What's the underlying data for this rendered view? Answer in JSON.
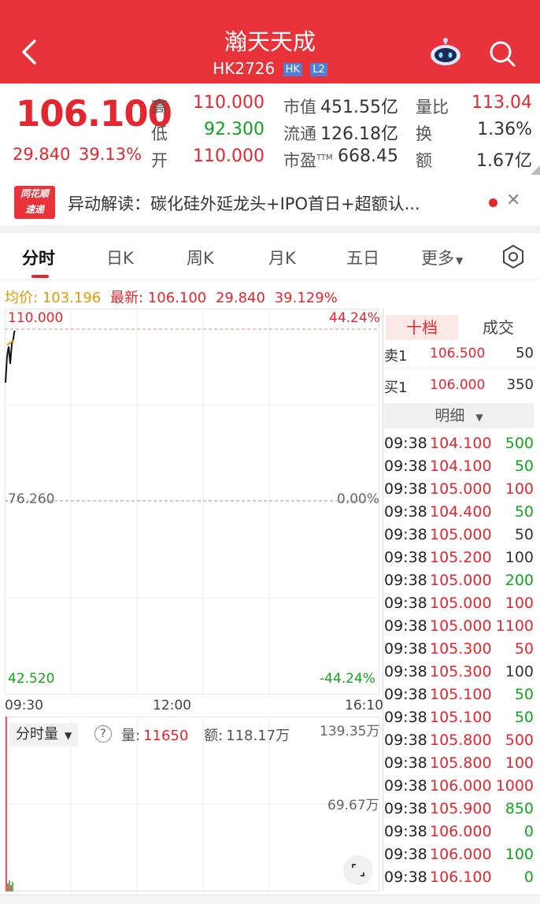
{
  "header": {
    "title": "瀚天天成",
    "code": "HK2726",
    "tag_market": "HK",
    "tag_level": "L2",
    "color": "#e8333a"
  },
  "quote": {
    "price": "106.100",
    "change": "29.840",
    "change_pct": "39.13%",
    "high_label": "高",
    "high": "110.000",
    "low_label": "低",
    "low": "92.300",
    "open_label": "开",
    "open": "110.000",
    "mcap_label": "市值",
    "mcap": "451.55亿",
    "float_label": "流通",
    "float": "126.18亿",
    "pe_label": "市盈",
    "pe_sup": "TTM",
    "pe": "668.45",
    "volratio_label": "量比",
    "volratio": "113.04",
    "turnover_label": "换",
    "turnover": "1.36%",
    "amount_label": "额",
    "amount": "1.67亿"
  },
  "news": {
    "logo_line1": "同花顺",
    "logo_line2": "速递",
    "text": "异动解读：碳化硅外延龙头+IPO首日+超额认..."
  },
  "tabs": [
    "分时",
    "日K",
    "周K",
    "月K",
    "五日",
    "更多"
  ],
  "avg": {
    "avg_label": "均价:",
    "avg_value": "103.196",
    "latest_label": "最新:",
    "latest_value": "106.100",
    "change": "29.840",
    "change_pct": "39.129%"
  },
  "chart": {
    "top_price": "110.000",
    "top_pct": "44.24%",
    "mid_price": "76.260",
    "mid_pct": "0.00%",
    "bottom_price": "42.520",
    "bottom_pct": "-44.24%",
    "time_start": "09:30",
    "time_mid": "12:00",
    "time_end": "16:10"
  },
  "volume": {
    "selector": "分时量",
    "vol_label": "量:",
    "vol_value": "11650",
    "amt_label": "额:",
    "amt_value": "118.17万",
    "axis_top": "139.35万",
    "axis_mid": "69.67万"
  },
  "side": {
    "tab_active": "十档",
    "tab_inactive": "成交",
    "ask_label": "卖1",
    "ask_price": "106.500",
    "ask_vol": "50",
    "bid_label": "买1",
    "bid_price": "106.000",
    "bid_vol": "350",
    "detail": "明细",
    "trades": [
      {
        "t": "09:38",
        "p": "104.100",
        "v": "500",
        "vc": "green"
      },
      {
        "t": "09:38",
        "p": "104.100",
        "v": "50",
        "vc": "green"
      },
      {
        "t": "09:38",
        "p": "105.000",
        "v": "100",
        "vc": "red"
      },
      {
        "t": "09:38",
        "p": "104.400",
        "v": "50",
        "vc": "green"
      },
      {
        "t": "09:38",
        "p": "105.000",
        "v": "50",
        "vc": "dark"
      },
      {
        "t": "09:38",
        "p": "105.200",
        "v": "100",
        "vc": "dark"
      },
      {
        "t": "09:38",
        "p": "105.000",
        "v": "200",
        "vc": "green"
      },
      {
        "t": "09:38",
        "p": "105.000",
        "v": "100",
        "vc": "red"
      },
      {
        "t": "09:38",
        "p": "105.000",
        "v": "1100",
        "vc": "red"
      },
      {
        "t": "09:38",
        "p": "105.300",
        "v": "50",
        "vc": "red"
      },
      {
        "t": "09:38",
        "p": "105.300",
        "v": "100",
        "vc": "dark"
      },
      {
        "t": "09:38",
        "p": "105.100",
        "v": "50",
        "vc": "green"
      },
      {
        "t": "09:38",
        "p": "105.100",
        "v": "50",
        "vc": "green"
      },
      {
        "t": "09:38",
        "p": "105.800",
        "v": "500",
        "vc": "red"
      },
      {
        "t": "09:38",
        "p": "105.800",
        "v": "100",
        "vc": "red"
      },
      {
        "t": "09:38",
        "p": "106.000",
        "v": "1000",
        "vc": "red"
      },
      {
        "t": "09:38",
        "p": "105.900",
        "v": "850",
        "vc": "green"
      },
      {
        "t": "09:38",
        "p": "106.000",
        "v": "0",
        "vc": "green"
      },
      {
        "t": "09:38",
        "p": "106.000",
        "v": "100",
        "vc": "green"
      },
      {
        "t": "09:38",
        "p": "106.100",
        "v": "0",
        "vc": "green"
      }
    ]
  },
  "colors": {
    "up": "#e4272f",
    "down": "#14a31e",
    "avg": "#e39a00"
  }
}
